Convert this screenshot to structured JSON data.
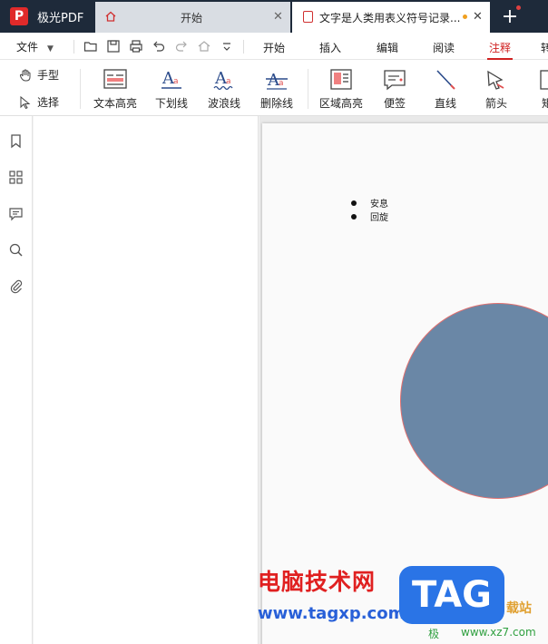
{
  "app": {
    "name": "极光PDF",
    "logo_letter": "P"
  },
  "tabs": [
    {
      "label": "开始",
      "type": "home"
    },
    {
      "label": "文字是人类用表义符号记录...",
      "type": "document",
      "modified": true
    }
  ],
  "menubar": {
    "file_label": "文件",
    "items": [
      "开始",
      "插入",
      "编辑",
      "阅读",
      "注释",
      "转"
    ],
    "active": "注释"
  },
  "ribbon": {
    "modes": [
      "手型",
      "选择"
    ],
    "tools": [
      "文本高亮",
      "下划线",
      "波浪线",
      "删除线",
      "区域高亮",
      "便签",
      "直线",
      "箭头",
      "矩"
    ]
  },
  "document": {
    "bullets": [
      "安息",
      "回旋"
    ],
    "shape": {
      "type": "circle",
      "fill": "#6a87a6",
      "stroke": "#e07070"
    }
  },
  "watermark": {
    "title": "电脑技术网",
    "url": "www.tagxp.com",
    "badge": "TAG",
    "side_text": "载站",
    "site2": "www.xz7.com",
    "ji": "极"
  },
  "colors": {
    "tabbar": "#1e2a3a",
    "accent": "#d02020",
    "brand_red": "#e02a2a",
    "watermark_blue": "#2a74e6"
  }
}
